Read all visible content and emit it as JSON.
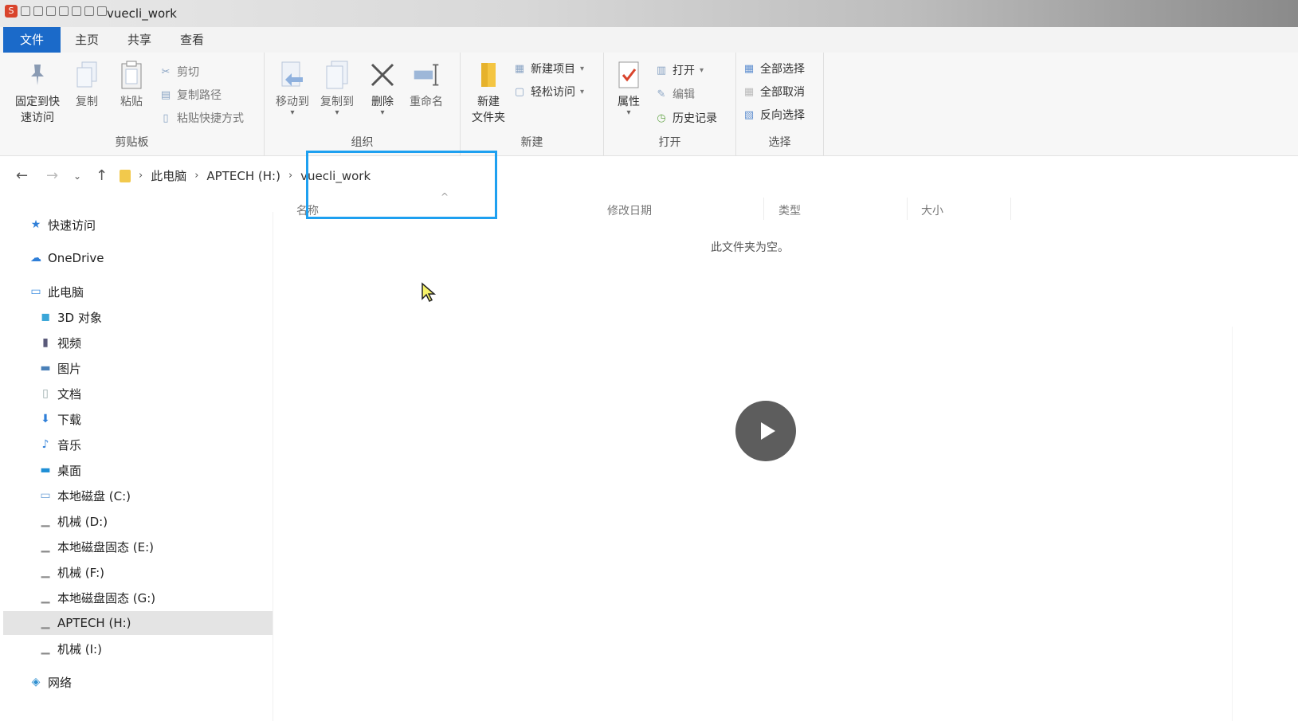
{
  "window": {
    "title": "vuecli_work"
  },
  "ribbon_tabs": [
    "文件",
    "主页",
    "共享",
    "查看"
  ],
  "clipboard": {
    "pin_label_line1": "固定到快",
    "pin_label_line2": "速访问",
    "copy": "复制",
    "paste": "粘贴",
    "cut": "剪切",
    "copy_path": "复制路径",
    "paste_shortcut": "粘贴快捷方式",
    "group_label": "剪贴板"
  },
  "organize": {
    "move_to": "移动到",
    "copy_to": "复制到",
    "delete": "删除",
    "rename": "重命名",
    "group_label": "组织"
  },
  "new": {
    "new_folder_line1": "新建",
    "new_folder_line2": "文件夹",
    "new_item": "新建项目",
    "easy_access": "轻松访问",
    "group_label": "新建"
  },
  "open": {
    "properties": "属性",
    "open": "打开",
    "edit": "编辑",
    "history": "历史记录",
    "group_label": "打开"
  },
  "select": {
    "select_all": "全部选择",
    "select_none": "全部取消",
    "invert": "反向选择",
    "group_label": "选择"
  },
  "breadcrumb": [
    "此电脑",
    "APTECH (H:)",
    "vuecli_work"
  ],
  "columns": {
    "name": "名称",
    "date": "修改日期",
    "type": "类型",
    "size": "大小"
  },
  "empty_message": "此文件夹为空。",
  "sidebar": {
    "quick_access": "快速访问",
    "onedrive": "OneDrive",
    "this_pc": "此电脑",
    "items": [
      "3D 对象",
      "视频",
      "图片",
      "文档",
      "下载",
      "音乐",
      "桌面",
      "本地磁盘 (C:)",
      "机械 (D:)",
      "本地磁盘固态 (E:)",
      "机械 (F:)",
      "本地磁盘固态 (G:)",
      "APTECH (H:)",
      "机械 (I:)"
    ],
    "network": "网络",
    "selected": "APTECH (H:)"
  },
  "colors": {
    "accent": "#1b6ac9",
    "highlight_box": "#1ea0f0",
    "selection_bg": "#e4e4e4"
  }
}
